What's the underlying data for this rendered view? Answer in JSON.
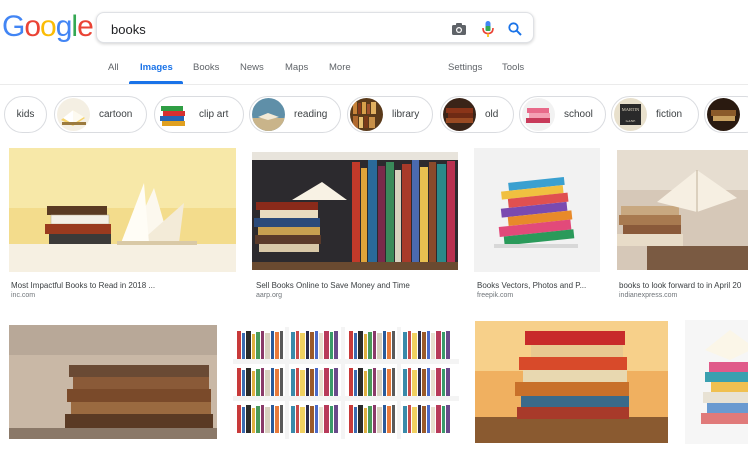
{
  "logo": {
    "letters": [
      "G",
      "o",
      "o",
      "g",
      "l",
      "e"
    ],
    "colors": [
      "#4285f4",
      "#ea4335",
      "#fbbc05",
      "#4285f4",
      "#34a853",
      "#ea4335"
    ]
  },
  "search": {
    "value": "books"
  },
  "icons": {
    "camera": "camera-icon",
    "mic": "microphone-icon",
    "search": "search-icon"
  },
  "tabs": {
    "all": "All",
    "images": "Images",
    "books": "Books",
    "news": "News",
    "maps": "Maps",
    "more": "More",
    "settings": "Settings",
    "tools": "Tools"
  },
  "accent": "#1a73e8",
  "chips": [
    "kids",
    "cartoon",
    "clip art",
    "reading",
    "library",
    "old",
    "school",
    "fiction"
  ],
  "results": [
    {
      "title": "Most Impactful Books to Read in 2018 ...",
      "source": "inc.com"
    },
    {
      "title": "Sell Books Online to Save Money and Time",
      "source": "aarp.org"
    },
    {
      "title": "Books Vectors, Photos and P...",
      "source": "freepik.com"
    },
    {
      "title": "books to look forward to in April 20",
      "source": "indianexpress.com"
    },
    {
      "title": "",
      "source": ""
    },
    {
      "title": "",
      "source": ""
    },
    {
      "title": "",
      "source": ""
    },
    {
      "title": "",
      "source": ""
    }
  ],
  "chip_thumb_text": {
    "fiction_top": "MARTIN",
    "fiction_bottom": "GANE"
  }
}
